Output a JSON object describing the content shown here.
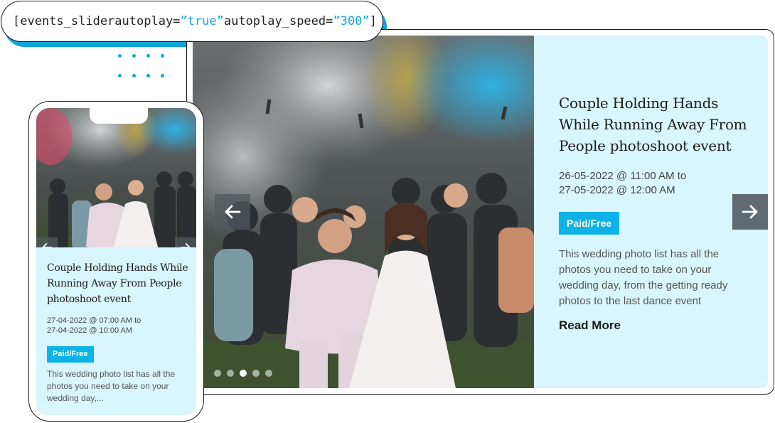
{
  "shortcode": {
    "tag": "[events_slider",
    "attr1_name": " autoplay=",
    "attr1_value": "”true”",
    "attr2_name": " autoplay_speed=",
    "attr2_value": "”300”",
    "close": "]"
  },
  "desktop": {
    "title": "Couple Holding Hands While Running Away From People photoshoot event",
    "date_start": "26-05-2022 @ 11:00 AM to",
    "date_end": "27-05-2022 @ 12:00 AM",
    "badge": "Paid/Free",
    "description": "This wedding photo list has all the photos you need to take on your wedding day, from the getting ready photos to the last dance event",
    "read_more": "Read More",
    "pager_active_index": 2,
    "pager_count": 5
  },
  "mobile": {
    "title": "Couple Holding Hands While Running Away From People photoshoot event",
    "date_start": "27-04-2022 @ 07:00 AM to",
    "date_end": "27-04-2022 @ 10:00 AM",
    "badge": "Paid/Free",
    "description": "This wedding photo list has all the photos you need to take on your wedding day,..."
  },
  "colors": {
    "accent": "#0db2e6",
    "info_bg": "#d9f5fd",
    "shortcode_value": "#16a8d8",
    "nav_button": "#5f6b70"
  },
  "icons": {
    "prev": "arrow-left-icon",
    "next": "arrow-right-icon"
  }
}
